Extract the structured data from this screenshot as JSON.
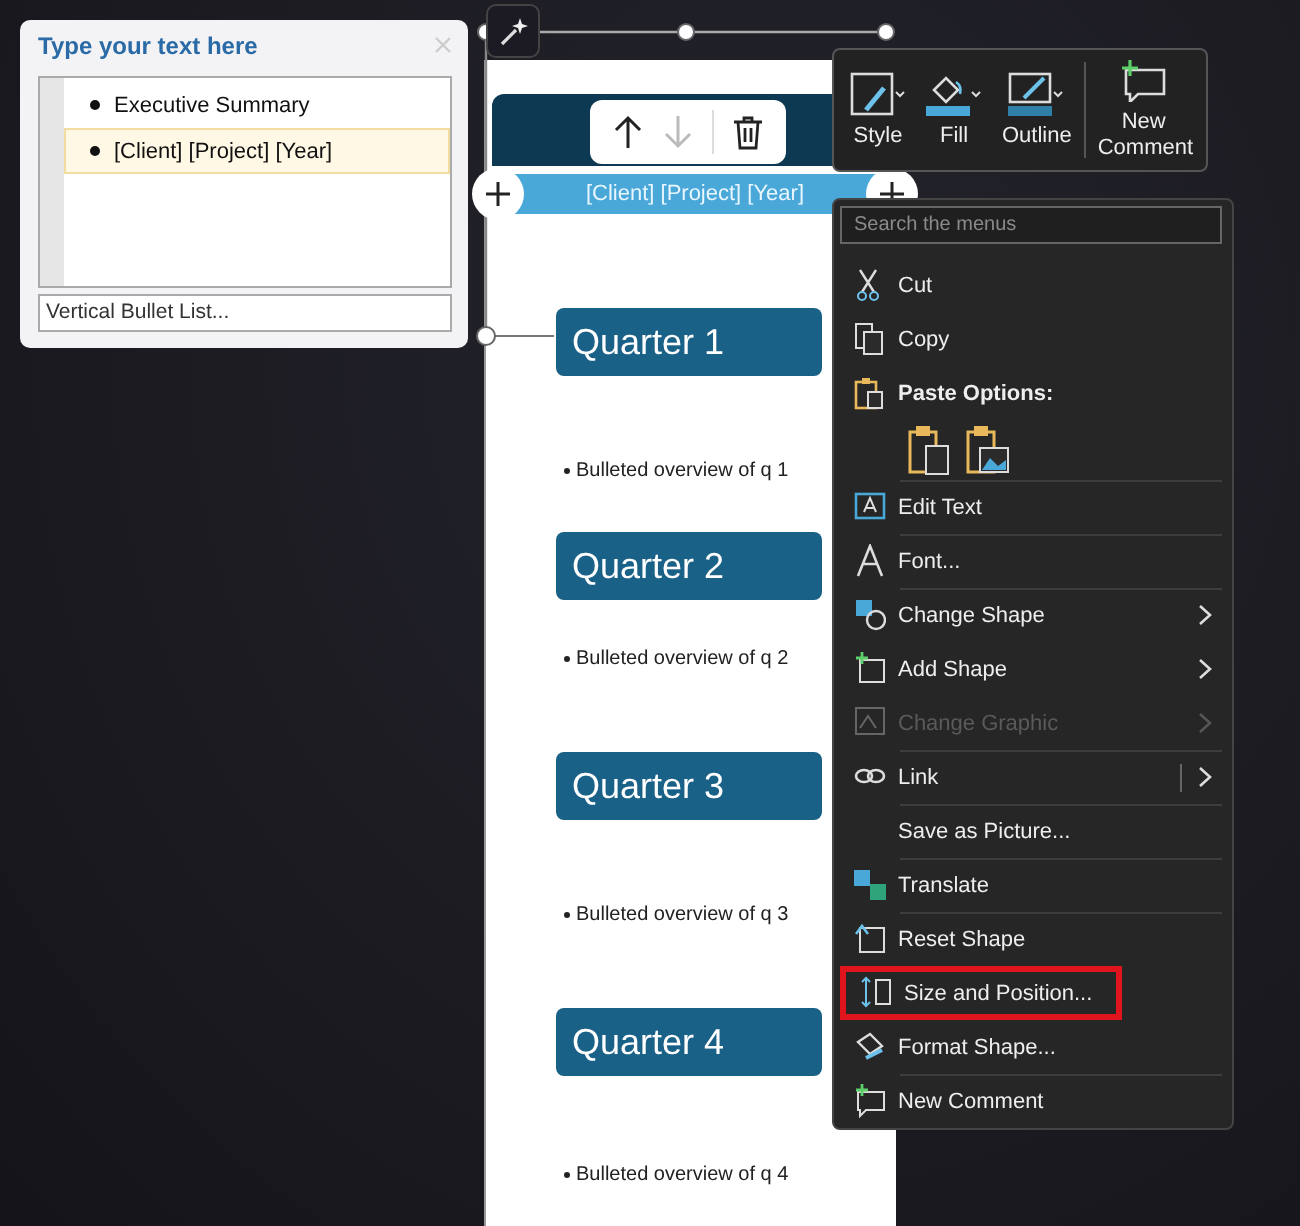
{
  "text_pane": {
    "title": "Type your text here",
    "items": [
      {
        "text": "Executive Summary",
        "selected": false
      },
      {
        "text": "[Client] [Project] [Year]",
        "selected": true
      }
    ],
    "footer": "Vertical Bullet List..."
  },
  "format_toolbar": {
    "buttons": [
      {
        "label": "Style"
      },
      {
        "label": "Fill"
      },
      {
        "label": "Outline"
      },
      {
        "label": "New Comment"
      }
    ]
  },
  "slide": {
    "title_bar": "[Client] [Project] [Year]",
    "sections": [
      {
        "heading": "Quarter 1",
        "bullet": "Bulleted overview of q 1"
      },
      {
        "heading": "Quarter 2",
        "bullet": "Bulleted overview of q 2"
      },
      {
        "heading": "Quarter 3",
        "bullet": "Bulleted overview of q 3"
      },
      {
        "heading": "Quarter 4",
        "bullet": "Bulleted overview of q 4"
      }
    ]
  },
  "context_menu": {
    "search_placeholder": "Search the menus",
    "items": [
      {
        "kind": "item",
        "label": "Cut",
        "disabled": false,
        "submenu": false,
        "highlighted": false,
        "divider": false
      },
      {
        "kind": "item",
        "label": "Copy",
        "disabled": false,
        "submenu": false,
        "highlighted": false,
        "divider": false
      },
      {
        "kind": "header",
        "label": "Paste Options:"
      },
      {
        "kind": "paste_icons"
      },
      {
        "kind": "item",
        "label": "Edit Text",
        "disabled": false,
        "submenu": false,
        "highlighted": false,
        "divider": true
      },
      {
        "kind": "item",
        "label": "Font...",
        "disabled": false,
        "submenu": false,
        "highlighted": false,
        "divider": true
      },
      {
        "kind": "item",
        "label": "Change Shape",
        "disabled": false,
        "submenu": true,
        "highlighted": false,
        "divider": true
      },
      {
        "kind": "item",
        "label": "Add Shape",
        "disabled": false,
        "submenu": true,
        "highlighted": false,
        "divider": false
      },
      {
        "kind": "item",
        "label": "Change Graphic",
        "disabled": true,
        "submenu": true,
        "highlighted": false,
        "divider": false
      },
      {
        "kind": "item",
        "label": "Link",
        "disabled": false,
        "submenu": true,
        "highlighted": false,
        "divider": true
      },
      {
        "kind": "item",
        "label": "Save as Picture...",
        "disabled": false,
        "submenu": false,
        "highlighted": false,
        "divider": true
      },
      {
        "kind": "item",
        "label": "Translate",
        "disabled": false,
        "submenu": false,
        "highlighted": false,
        "divider": true
      },
      {
        "kind": "item",
        "label": "Reset Shape",
        "disabled": false,
        "submenu": false,
        "highlighted": false,
        "divider": true
      },
      {
        "kind": "item",
        "label": "Size and Position...",
        "disabled": false,
        "submenu": false,
        "highlighted": true,
        "divider": false
      },
      {
        "kind": "item",
        "label": "Format Shape...",
        "disabled": false,
        "submenu": false,
        "highlighted": false,
        "divider": false
      },
      {
        "kind": "item",
        "label": "New Comment",
        "disabled": false,
        "submenu": false,
        "highlighted": false,
        "divider": true
      }
    ]
  }
}
